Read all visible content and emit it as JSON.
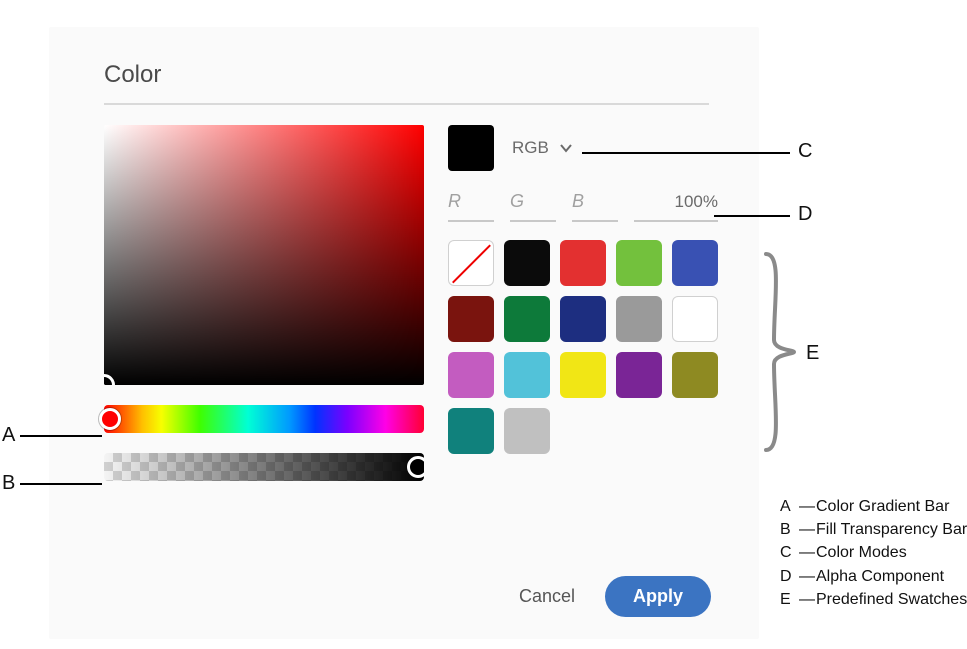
{
  "panel": {
    "title": "Color",
    "mode": {
      "label": "RGB"
    },
    "channels": {
      "r": "R",
      "g": "G",
      "b": "B"
    },
    "alpha": {
      "value": "100%"
    },
    "swatches": [
      {
        "name": "none",
        "color": null
      },
      {
        "name": "black",
        "color": "#0b0b0b"
      },
      {
        "name": "red",
        "color": "#e33030"
      },
      {
        "name": "green",
        "color": "#73c13d"
      },
      {
        "name": "blue",
        "color": "#3951b3"
      },
      {
        "name": "maroon",
        "color": "#7a140e"
      },
      {
        "name": "forest",
        "color": "#0d7a3a"
      },
      {
        "name": "navy",
        "color": "#1d2e80"
      },
      {
        "name": "gray",
        "color": "#9a9a9a"
      },
      {
        "name": "white",
        "color": "#ffffff"
      },
      {
        "name": "orchid",
        "color": "#c35cc0"
      },
      {
        "name": "sky",
        "color": "#52c2d9"
      },
      {
        "name": "yellow",
        "color": "#f1e615"
      },
      {
        "name": "purple",
        "color": "#7a2596"
      },
      {
        "name": "olive",
        "color": "#8e8a22"
      },
      {
        "name": "teal",
        "color": "#10817c"
      },
      {
        "name": "silver",
        "color": "#c0c0c0"
      }
    ],
    "buttons": {
      "cancel": "Cancel",
      "apply": "Apply"
    }
  },
  "callouts": {
    "a": {
      "key": "A",
      "text": "Color Gradient Bar"
    },
    "b": {
      "key": "B",
      "text": "Fill Transparency Bar"
    },
    "c": {
      "key": "C",
      "text": "Color Modes"
    },
    "d": {
      "key": "D",
      "text": "Alpha Component"
    },
    "e": {
      "key": "E",
      "text": "Predefined Swatches"
    }
  }
}
